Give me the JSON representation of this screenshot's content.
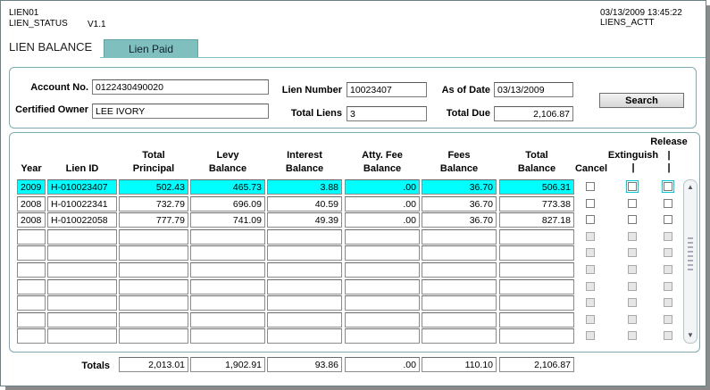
{
  "header": {
    "form_id": "LIEN01",
    "form_name": "LIEN_STATUS",
    "version": "V1.1",
    "datetime": "03/13/2009 13:45:22",
    "user_role": "LIENS_ACTT"
  },
  "tabs": [
    {
      "label": "LIEN BALANCE",
      "active": true
    },
    {
      "label": "Lien Paid",
      "active": false
    }
  ],
  "query": {
    "account_label": "Account No.",
    "account_value": "0122430490020",
    "owner_label": "Certified Owner",
    "owner_value": "LEE IVORY",
    "lien_number_label": "Lien Number",
    "lien_number_value": "10023407",
    "total_liens_label": "Total Liens",
    "total_liens_value": "3",
    "as_of_label": "As of Date",
    "as_of_value": "03/13/2009",
    "total_due_label": "Total Due",
    "total_due_value": "2,106.87",
    "search_label": "Search"
  },
  "grid": {
    "columns": {
      "year": "Year",
      "lien_id": "Lien ID",
      "total_principal_1": "Total",
      "total_principal_2": "Principal",
      "levy_1": "Levy",
      "levy_2": "Balance",
      "interest_1": "Interest",
      "interest_2": "Balance",
      "atty_1": "Atty. Fee",
      "atty_2": "Balance",
      "fees_1": "Fees",
      "fees_2": "Balance",
      "total_bal_1": "Total",
      "total_bal_2": "Balance",
      "cancel": "Cancel",
      "extinguish": "Extinguish",
      "release": "Release"
    },
    "rows": [
      {
        "year": "2009",
        "lien_id": "H-010023407",
        "principal": "502.43",
        "levy": "465.73",
        "interest": "3.88",
        "atty": ".00",
        "fees": "36.70",
        "total": "506.31"
      },
      {
        "year": "2008",
        "lien_id": "H-010022341",
        "principal": "732.79",
        "levy": "696.09",
        "interest": "40.59",
        "atty": ".00",
        "fees": "36.70",
        "total": "773.38"
      },
      {
        "year": "2008",
        "lien_id": "H-010022058",
        "principal": "777.79",
        "levy": "741.09",
        "interest": "49.39",
        "atty": ".00",
        "fees": "36.70",
        "total": "827.18"
      }
    ],
    "empty_rows": 7,
    "selected_row": 0
  },
  "totals": {
    "label": "Totals",
    "principal": "2,013.01",
    "levy": "1,902.91",
    "interest": "93.86",
    "atty": ".00",
    "fees": "110.10",
    "total": "2,106.87"
  },
  "colors": {
    "selected_row": "#00ffff",
    "tab_bg": "#7fc0bf",
    "panel_border": "#7faab0"
  }
}
